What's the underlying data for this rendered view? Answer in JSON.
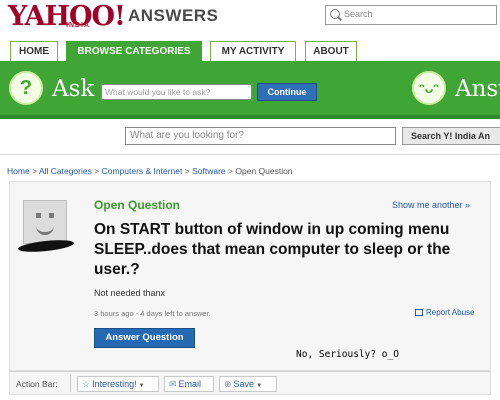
{
  "header": {
    "logo_text": "YAHOO!",
    "logo_sub": "INDIA",
    "product": "ANSWERS",
    "search_placeholder": "Search"
  },
  "tabs": [
    {
      "label": "HOME",
      "active": false
    },
    {
      "label": "BROWSE CATEGORIES",
      "active": true
    },
    {
      "label": "MY ACTIVITY",
      "active": false
    },
    {
      "label": "ABOUT",
      "active": false
    }
  ],
  "ask_bar": {
    "smiley_glyph": "?",
    "ask_label": "Ask",
    "input_placeholder": "What would you like to ask?",
    "continue_label": "Continue",
    "answer_label": "Answ"
  },
  "lookup": {
    "placeholder": "What are you looking for?",
    "button_label": "Search Y! India An"
  },
  "breadcrumb": {
    "items": [
      "Home",
      "All Categories",
      "Computers & Internet",
      "Software"
    ],
    "separator": ">",
    "current": "Open Question"
  },
  "question": {
    "status_label": "Open Question",
    "show_another": "Show me another »",
    "title": "On START button of window in up coming menu SLEEP..does that mean computer to sleep or the user.?",
    "details": "Not needed thanx",
    "meta": "3 hours ago - 4 days left to answer.",
    "report_label": "Report Abuse",
    "answer_button": "Answer Question",
    "overlay_caption": "No, Seriously? o_O"
  },
  "action_bar": {
    "label": "Action Bar:",
    "interesting": "Interesting!",
    "email": "Email",
    "save": "Save"
  },
  "colors": {
    "brand_green": "#3fa535",
    "link_blue": "#2559a8",
    "button_blue": "#246ab2",
    "logo_red": "#a0002a"
  }
}
